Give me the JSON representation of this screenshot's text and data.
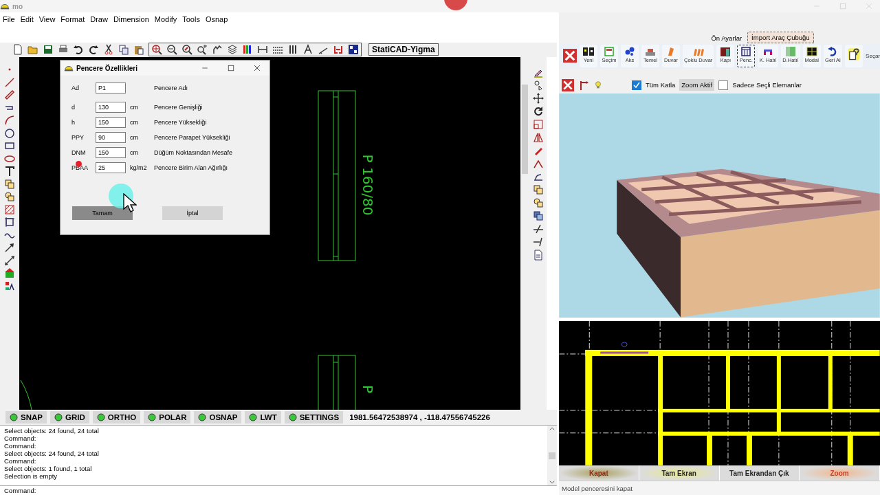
{
  "window": {
    "title": "mo"
  },
  "menu": [
    "File",
    "Edit",
    "View",
    "Format",
    "Draw",
    "Dimension",
    "Modify",
    "Tools",
    "Osnap"
  ],
  "toolbar": {
    "label": "StatiCAD-Yigma"
  },
  "canvas": {
    "labels": [
      "P 160/80",
      "P"
    ]
  },
  "dialog": {
    "title": "Pencere Özellikleri",
    "fields": [
      {
        "label": "Ad",
        "value": "P1",
        "description": "Pencere Adı"
      },
      {
        "label": "d",
        "value": "130",
        "unit": "cm",
        "description": "Pencere Genişliği"
      },
      {
        "label": "h",
        "value": "150",
        "unit": "cm",
        "description": "Pencere Yüksekliği"
      },
      {
        "label": "PPY",
        "value": "90",
        "unit": "cm",
        "description": "Pencere Parapet Yüksekliği"
      },
      {
        "label": "DNM",
        "value": "150",
        "unit": "cm",
        "description": "Düğüm Noktasından Mesafe"
      },
      {
        "label": "PBAA",
        "value": "25",
        "unit": "kg/m2",
        "description": "Pencere Birim Alan Ağırlığı"
      }
    ],
    "buttons": [
      {
        "label": "Tamam",
        "pressed": true
      },
      {
        "label": "İptal",
        "pressed": false
      }
    ]
  },
  "status_toggles": [
    {
      "label": "SNAP",
      "on": true
    },
    {
      "label": "GRID",
      "on": true
    },
    {
      "label": "ORTHO",
      "on": true
    },
    {
      "label": "POLAR",
      "on": true
    },
    {
      "label": "OSNAP",
      "on": true
    },
    {
      "label": "LWT",
      "on": true
    },
    {
      "label": "SETTINGS",
      "on": true
    }
  ],
  "coordinates": "1981.56472538974 , -118.47556745226",
  "command_history": [
    "Select objects: 24 found,  24 total",
    "Command:",
    "Command:",
    "Select objects: 24 found,  24 total",
    "Command:",
    "Select objects: 1 found,  1 total",
    "Selection is empty"
  ],
  "command_prompt": "Command:",
  "model_panel": {
    "tabs": [
      {
        "label": "Ön Ayarlar",
        "selected": false
      },
      {
        "label": "İmport Araç Çubuğu",
        "selected": true
      }
    ],
    "tools": [
      {
        "kind": "labeled",
        "label": "Yeni",
        "selected": false
      },
      {
        "kind": "labeled",
        "label": "Seçim",
        "selected": false
      },
      {
        "kind": "labeled",
        "label": "Aks",
        "selected": false
      },
      {
        "kind": "labeled",
        "label": "Temel",
        "selected": false
      },
      {
        "kind": "labeled",
        "label": "Duvar",
        "selected": false
      },
      {
        "kind": "labeled",
        "label": "Çoklu Duvar",
        "selected": false
      },
      {
        "kind": "labeled",
        "label": "Kapı",
        "selected": false
      },
      {
        "kind": "labeled",
        "label": "Penc.",
        "selected": true
      },
      {
        "kind": "labeled",
        "label": "K. Hatıl",
        "selected": false
      },
      {
        "kind": "labeled",
        "label": "D.Hatıl",
        "selected": false
      },
      {
        "kind": "labeled",
        "label": "Modal",
        "selected": false
      },
      {
        "kind": "labeled",
        "label": "Geri Al",
        "selected": false
      },
      {
        "kind": "icon",
        "selected": false
      },
      {
        "kind": "text",
        "label": "Seçar"
      }
    ]
  },
  "view_options": [
    {
      "kind": "checkbox",
      "label": "Tüm Katla",
      "checked": true
    },
    {
      "kind": "toggle",
      "label": "Zoom Aktif",
      "on": true
    },
    {
      "kind": "checkbox",
      "label": "Sadece Seçli Elemanlar",
      "checked": false
    }
  ],
  "view_buttons": [
    {
      "label": "Kapat",
      "color": "#8b2a1a"
    },
    {
      "label": "Tam Ekran",
      "color": "#222222"
    },
    {
      "label": "Tam Ekrandan Çık",
      "color": "#222222"
    },
    {
      "label": "Zoom",
      "color": "#c8402a"
    }
  ],
  "status_text": "Model penceresini kapat"
}
